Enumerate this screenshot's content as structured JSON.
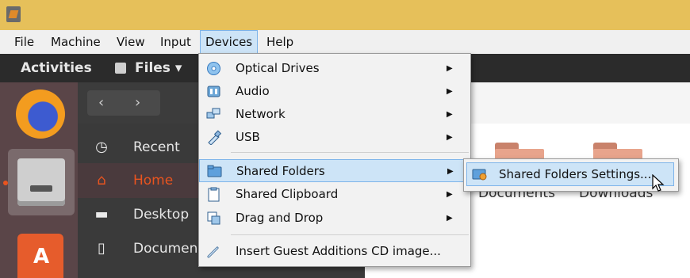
{
  "menubar": {
    "items": [
      "File",
      "Machine",
      "View",
      "Input",
      "Devices",
      "Help"
    ]
  },
  "gnome": {
    "activities": "Activities",
    "app_menu": "Files ▾"
  },
  "files": {
    "nav": {
      "back": "‹",
      "forward": "›"
    },
    "sidebar": [
      {
        "label": "Recent",
        "icon": "clock-icon",
        "glyph": "◷"
      },
      {
        "label": "Home",
        "icon": "home-icon",
        "glyph": "⌂"
      },
      {
        "label": "Desktop",
        "icon": "folder-icon",
        "glyph": "▬"
      },
      {
        "label": "Documen",
        "icon": "document-icon",
        "glyph": "▯"
      }
    ],
    "folders": [
      "Documents",
      "Downloads"
    ]
  },
  "devices_menu": {
    "items": [
      {
        "label": "Optical Drives",
        "icon": "optical-drive-icon",
        "submenu": "▶"
      },
      {
        "label": "Audio",
        "icon": "audio-icon",
        "submenu": "▶"
      },
      {
        "label": "Network",
        "icon": "network-icon",
        "submenu": "▶"
      },
      {
        "label": "USB",
        "icon": "usb-icon",
        "submenu": "▶"
      },
      {
        "label": "Shared Folders",
        "icon": "shared-folder-icon",
        "submenu": "▶"
      },
      {
        "label": "Shared Clipboard",
        "icon": "clipboard-icon",
        "submenu": "▶"
      },
      {
        "label": "Drag and Drop",
        "icon": "drag-drop-icon",
        "submenu": "▶"
      },
      {
        "label": "Insert Guest Additions CD image...",
        "icon": "guest-additions-icon",
        "submenu": ""
      }
    ]
  },
  "shared_folders_submenu": {
    "label": "Shared Folders Settings..."
  },
  "colors": {
    "highlight": "#cde4f7",
    "highlight_border": "#7eb4ea",
    "title_bar": "#e6c05a",
    "accent": "#e9541f"
  }
}
